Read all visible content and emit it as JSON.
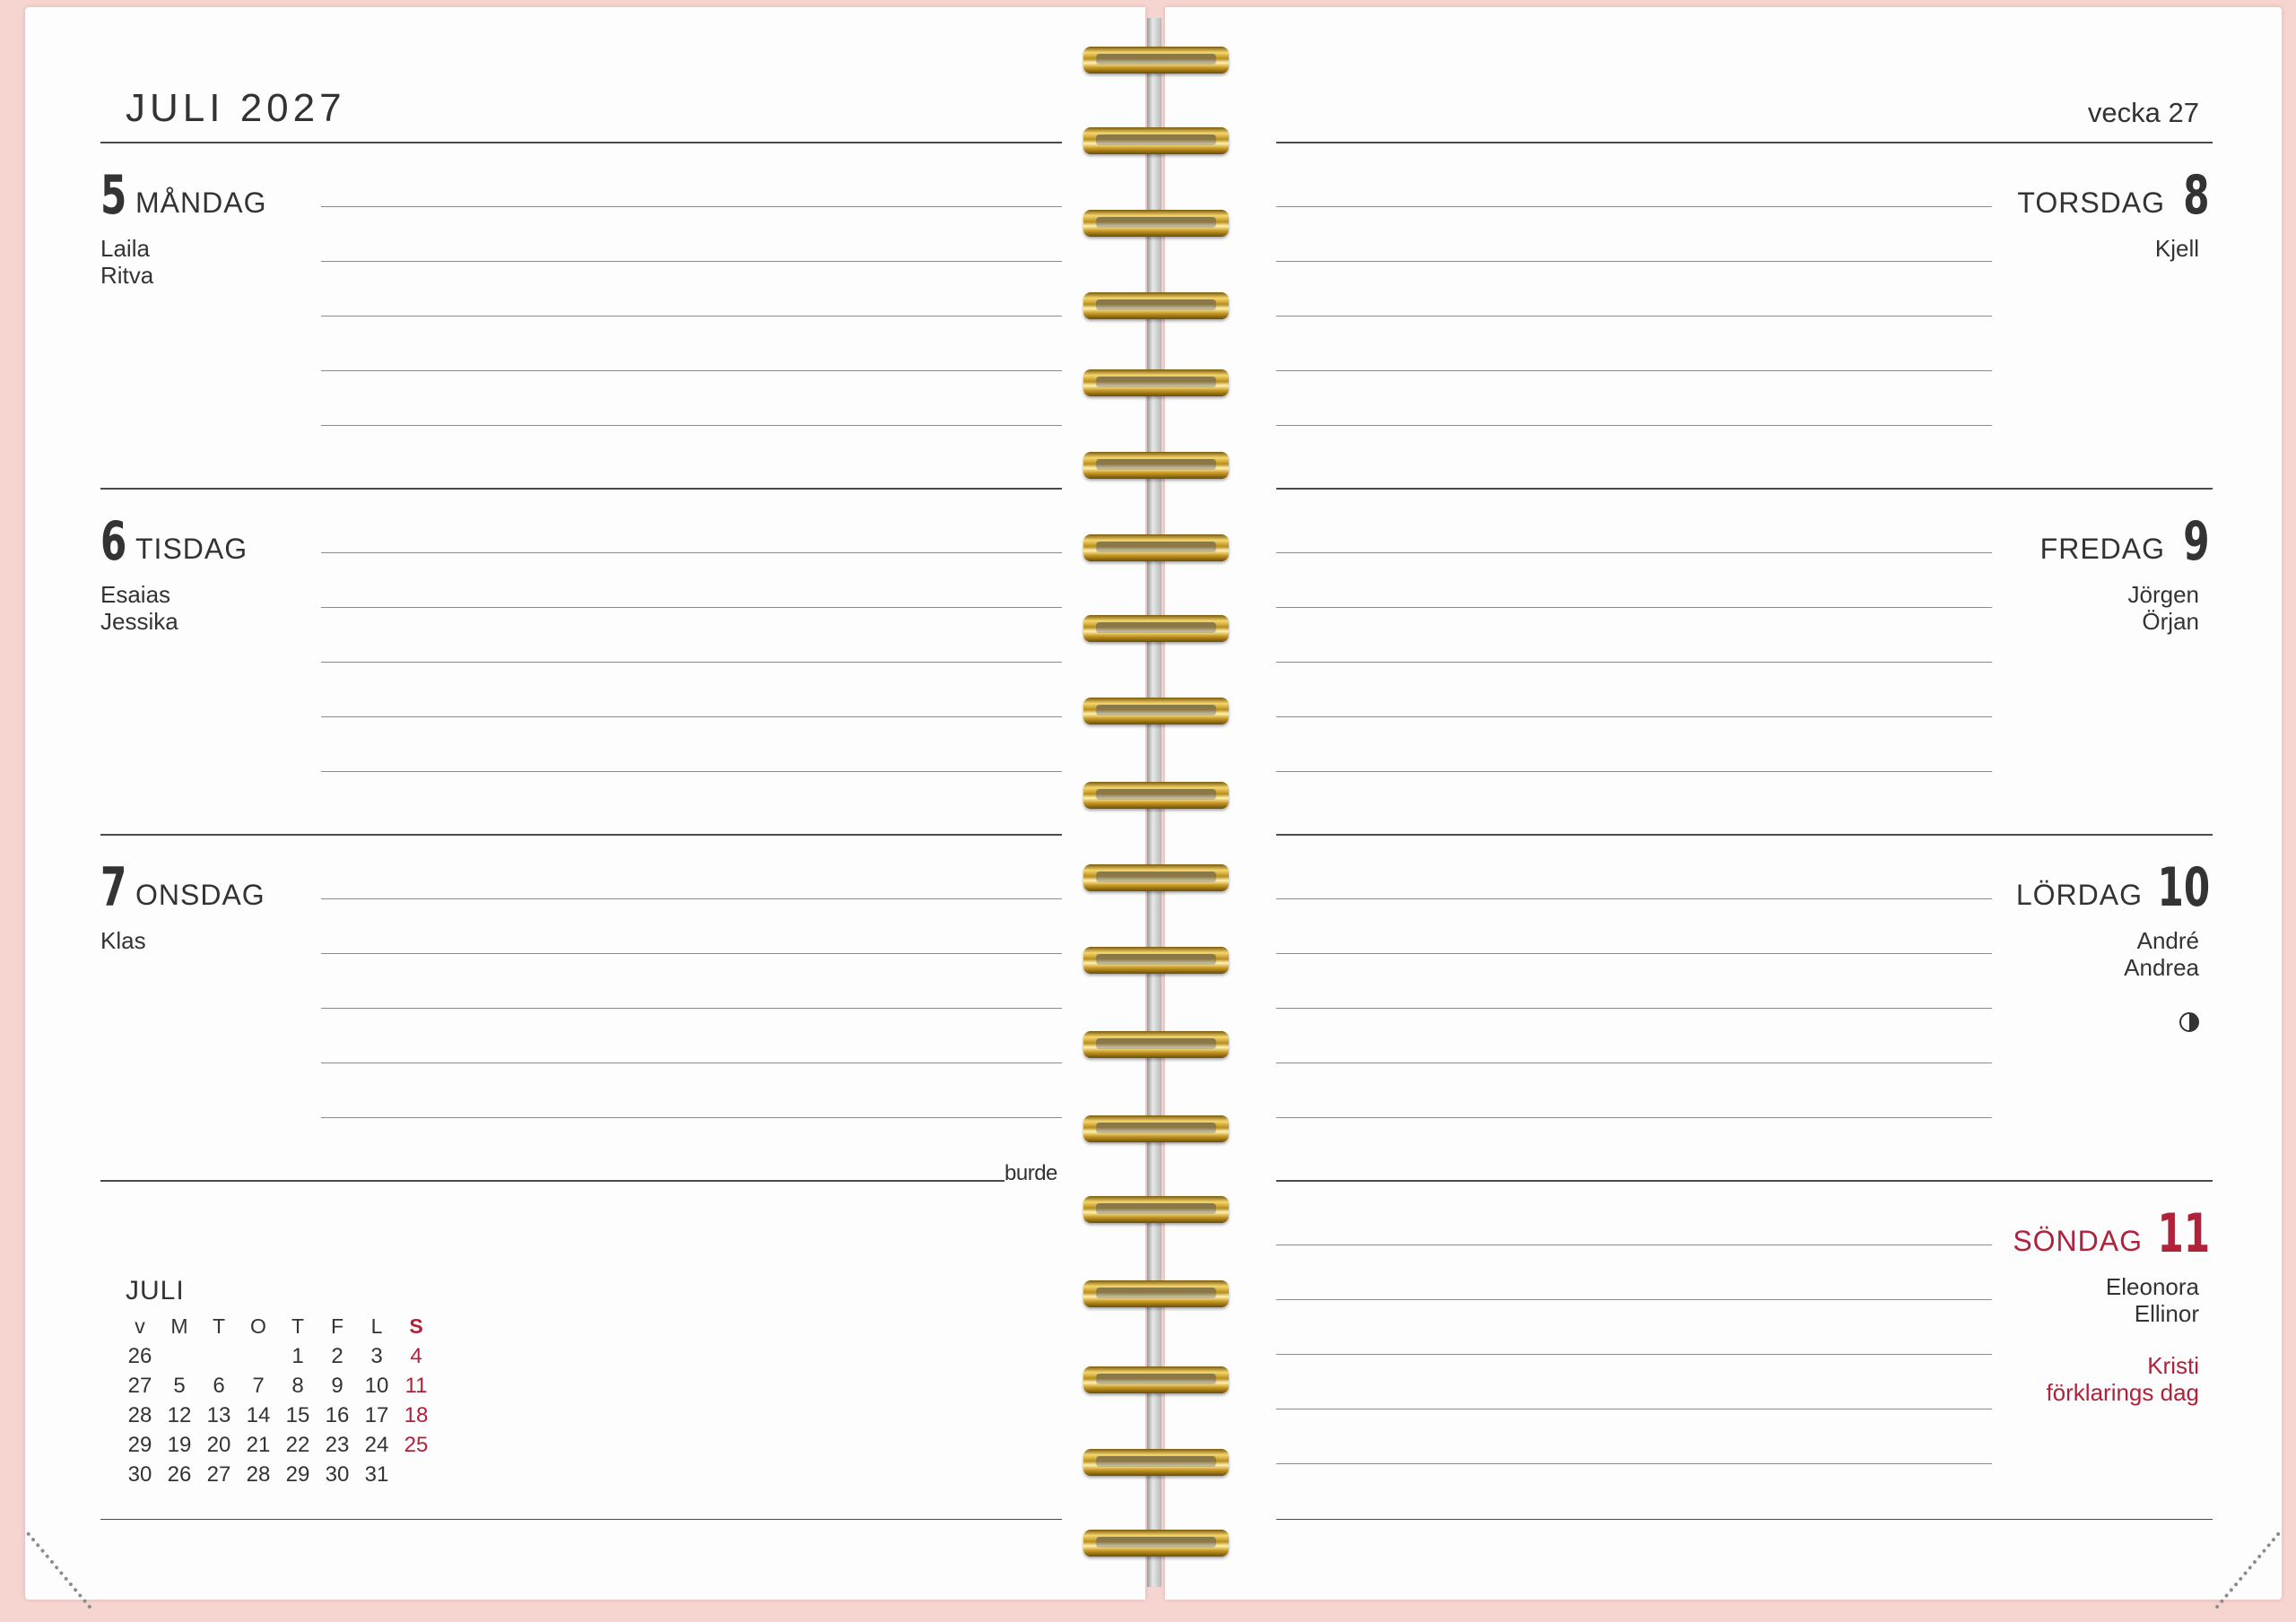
{
  "header": {
    "month_year": "JULI 2027",
    "week": "vecka 27"
  },
  "days_left": [
    {
      "num": "5",
      "name": "MÅNDAG",
      "namedays": [
        "Laila",
        "Ritva"
      ]
    },
    {
      "num": "6",
      "name": "TISDAG",
      "namedays": [
        "Esaias",
        "Jessika"
      ]
    },
    {
      "num": "7",
      "name": "ONSDAG",
      "namedays": [
        "Klas"
      ]
    }
  ],
  "days_right": [
    {
      "num": "8",
      "name": "TORSDAG",
      "namedays": [
        "Kjell"
      ]
    },
    {
      "num": "9",
      "name": "FREDAG",
      "namedays": [
        "Jörgen",
        "Örjan"
      ]
    },
    {
      "num": "10",
      "name": "LÖRDAG",
      "namedays": [
        "André",
        "Andrea"
      ],
      "moon": "first-quarter-moon-icon"
    },
    {
      "num": "11",
      "name": "SÖNDAG",
      "namedays": [
        "Eleonora",
        "Ellinor"
      ],
      "holiday": [
        "Kristi",
        "förklarings dag"
      ]
    }
  ],
  "brand": "burde",
  "mini_calendar": {
    "title": "JULI",
    "headers": [
      "v",
      "M",
      "T",
      "O",
      "T",
      "F",
      "L",
      "S"
    ],
    "rows": [
      [
        "26",
        "",
        "",
        "",
        "1",
        "2",
        "3",
        "4"
      ],
      [
        "27",
        "5",
        "6",
        "7",
        "8",
        "9",
        "10",
        "11"
      ],
      [
        "28",
        "12",
        "13",
        "14",
        "15",
        "16",
        "17",
        "18"
      ],
      [
        "29",
        "19",
        "20",
        "21",
        "22",
        "23",
        "24",
        "25"
      ],
      [
        "30",
        "26",
        "27",
        "28",
        "29",
        "30",
        "31",
        ""
      ]
    ]
  },
  "colors": {
    "sunday_red": "#b0213a",
    "cover_pink": "#f6d4cf",
    "coil_gold": "#c99a22"
  }
}
